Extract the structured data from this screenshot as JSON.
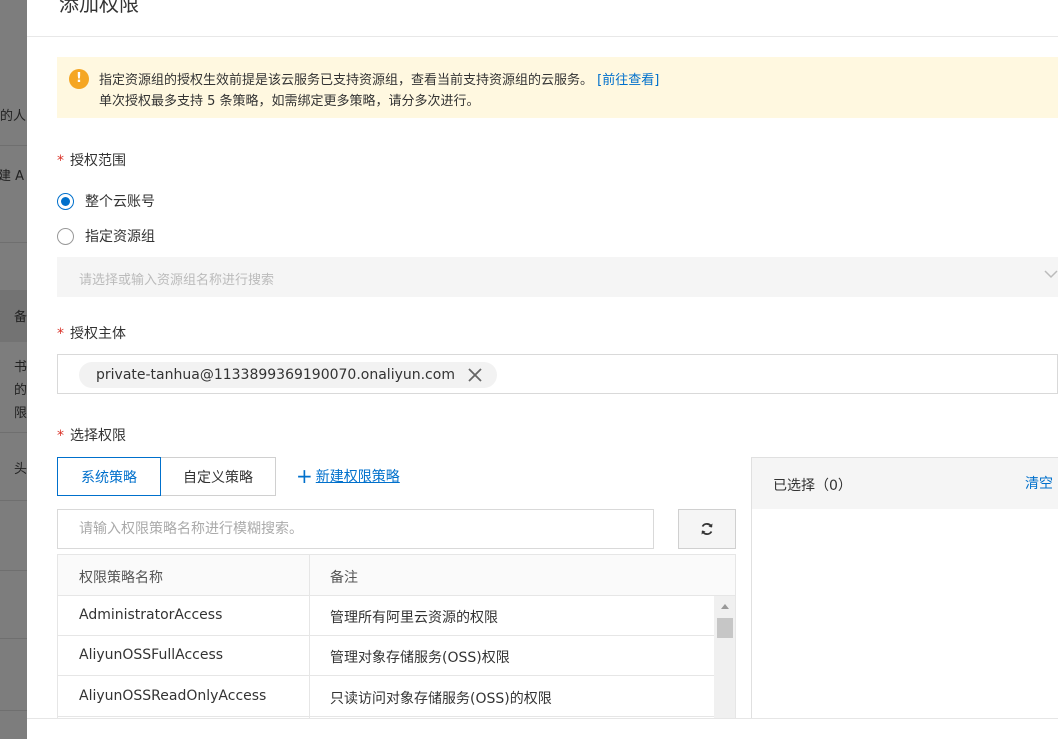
{
  "background": {
    "fragments": [
      "的人员",
      "建 A",
      "备",
      "书",
      "的",
      "限",
      "头"
    ]
  },
  "drawer": {
    "title": "添加权限"
  },
  "notice": {
    "line1": "指定资源组的授权生效前提是该云服务已支持资源组，查看当前支持资源组的云服务。",
    "link": "[前往查看]",
    "line2": "单次授权最多支持 5 条策略，如需绑定更多策略，请分多次进行。"
  },
  "scope": {
    "label": "授权范围",
    "options": [
      "整个云账号",
      "指定资源组"
    ],
    "selected": "整个云账号",
    "resource_group_placeholder": "请选择或输入资源组名称进行搜索"
  },
  "principal": {
    "label": "授权主体",
    "tag": "private-tanhua@1133899369190070.onaliyun.com"
  },
  "permissions": {
    "label": "选择权限",
    "tabs": [
      "系统策略",
      "自定义策略"
    ],
    "active_tab": "系统策略",
    "new_policy_label": "新建权限策略",
    "search_placeholder": "请输入权限策略名称进行模糊搜索。",
    "columns": [
      "权限策略名称",
      "备注"
    ],
    "rows": [
      {
        "name": "AdministratorAccess",
        "note": "管理所有阿里云资源的权限"
      },
      {
        "name": "AliyunOSSFullAccess",
        "note": "管理对象存储服务(OSS)权限"
      },
      {
        "name": "AliyunOSSReadOnlyAccess",
        "note": "只读访问对象存储服务(OSS)的权限"
      }
    ]
  },
  "selected": {
    "title": "已选择（0）",
    "clear_label": "清空"
  },
  "colors": {
    "accent": "#0070cc",
    "required": "#d93026",
    "warning": "#f5a623",
    "notice_bg": "#fff8e0"
  },
  "icons": {
    "notice": "warning-circle-icon",
    "tag_close": "close-icon",
    "refresh": "refresh-icon",
    "plus": "plus-icon",
    "chevron": "chevron-down-icon"
  }
}
